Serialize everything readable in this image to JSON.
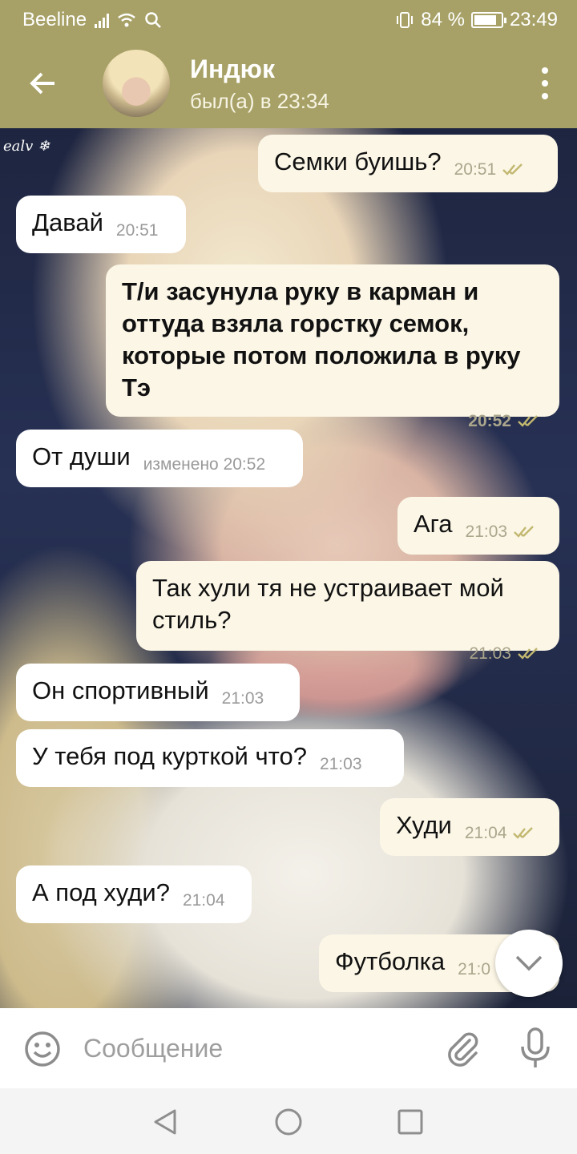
{
  "status_bar": {
    "carrier": "Beeline",
    "battery_percent": "84 %",
    "battery_level": 0.84,
    "time": "23:49"
  },
  "header": {
    "contact_name": "Индюк",
    "last_seen": "был(а) в 23:34"
  },
  "wallpaper": {
    "watermark": "ealv ❄"
  },
  "messages": [
    {
      "dir": "out",
      "text": "Семки буишь?",
      "time": "20:51",
      "read": true
    },
    {
      "dir": "in",
      "text": "Давай",
      "time": "20:51"
    },
    {
      "dir": "out",
      "text": "Т/и засунула руку в карман и оттуда взяла горстку семок, которые потом положила в руку Тэ",
      "time": "20:52",
      "read": true,
      "bold": true
    },
    {
      "dir": "in",
      "text": "От души",
      "time": "изменено 20:52"
    },
    {
      "dir": "out",
      "text": "Ага",
      "time": "21:03",
      "read": true
    },
    {
      "dir": "out",
      "text": "Так хули тя не устраивает мой стиль?",
      "time": "21:03",
      "read": true
    },
    {
      "dir": "in",
      "text": "Он спортивный",
      "time": "21:03"
    },
    {
      "dir": "in",
      "text": "У тебя под курткой что?",
      "time": "21:03"
    },
    {
      "dir": "out",
      "text": "Худи",
      "time": "21:04",
      "read": true
    },
    {
      "dir": "in",
      "text": "А под худи?",
      "time": "21:04"
    },
    {
      "dir": "out",
      "text": "Футболка",
      "time": "21:0",
      "read": true
    }
  ],
  "input": {
    "placeholder": "Сообщение"
  },
  "icons": {
    "back": "arrow-left-icon",
    "menu": "more-vertical-icon",
    "emoji": "smiley-icon",
    "attach": "paperclip-icon",
    "mic": "microphone-icon",
    "scroll_down": "chevron-down-icon",
    "nav_back": "triangle-back-icon",
    "nav_home": "circle-home-icon",
    "nav_recents": "square-recents-icon"
  },
  "colors": {
    "header_bg": "#a7a167",
    "incoming_bubble": "#ffffff",
    "outgoing_bubble": "#fbf6e6",
    "read_ticks": "#c2b870",
    "time_gray": "#9a9a9a"
  }
}
